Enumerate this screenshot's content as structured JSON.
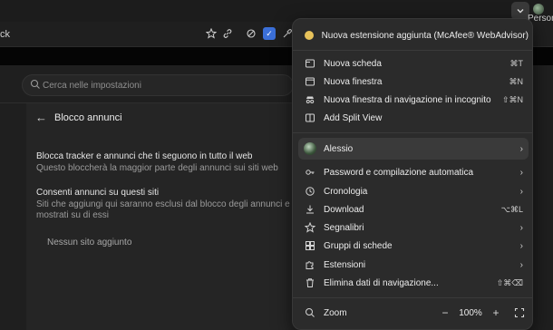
{
  "topbar": {
    "profile_label_1": "Persona",
    "profile_label_2": "nte"
  },
  "address": {
    "text": "ck"
  },
  "settings": {
    "search_placeholder": "Cerca nelle impostazioni",
    "panel_title": "Blocco annunci",
    "option1_title": "Blocca tracker e annunci che ti seguono in tutto il web",
    "option1_desc": "Questo bloccherà la maggior parte degli annunci sui siti web",
    "option2_title": "Consenti annunci su questi siti",
    "option2_desc_line1": "Siti che aggiungi qui saranno esclusi dal blocco degli annunci e gli annun",
    "option2_desc_line2": "mostrati su di essi",
    "empty_text": "Nessun sito aggiunto"
  },
  "menu": {
    "extension_notice": "Nuova estensione aggiunta (McAfee® WebAdvisor)",
    "new_tab": {
      "label": "Nuova scheda",
      "shortcut": "⌘T"
    },
    "new_window": {
      "label": "Nuova finestra",
      "shortcut": "⌘N"
    },
    "incognito": {
      "label": "Nuova finestra di navigazione in incognito",
      "shortcut": "⇧⌘N"
    },
    "split_view": {
      "label": "Add Split View"
    },
    "profile": {
      "label": "Alessio"
    },
    "passwords": {
      "label": "Password e compilazione automatica"
    },
    "history": {
      "label": "Cronologia"
    },
    "downloads": {
      "label": "Download",
      "shortcut": "⌥⌘L"
    },
    "bookmarks": {
      "label": "Segnalibri"
    },
    "tab_groups": {
      "label": "Gruppi di schede"
    },
    "extensions": {
      "label": "Estensioni"
    },
    "clear_data": {
      "label": "Elimina dati di navigazione...",
      "shortcut": "⇧⌘⌫"
    },
    "zoom": {
      "label": "Zoom",
      "minus": "−",
      "value": "100%",
      "plus": "+"
    }
  },
  "icons": {
    "chevron": "chevron-down-icon",
    "star": "star-icon",
    "link": "link-icon",
    "extension": "extension-icon",
    "eyedropper": "eyedropper-icon"
  }
}
